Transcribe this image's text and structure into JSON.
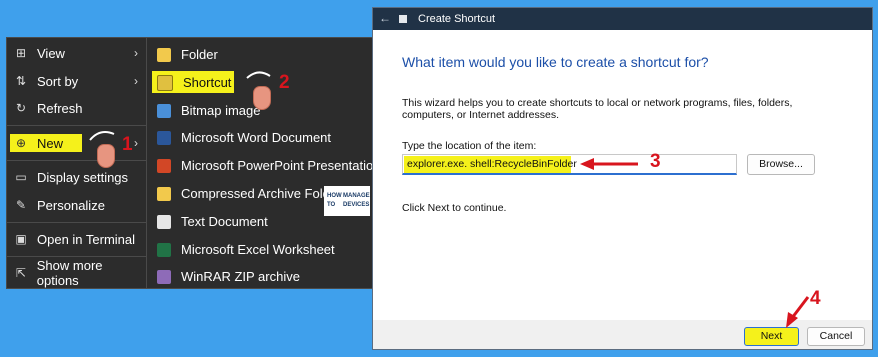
{
  "context_menu": {
    "items": [
      {
        "label": "View",
        "icon": "view-grid-icon",
        "glyph": "⊞",
        "arrow": "›"
      },
      {
        "label": "Sort by",
        "icon": "sort-icon",
        "glyph": "⇅",
        "arrow": "›"
      },
      {
        "label": "Refresh",
        "icon": "refresh-icon",
        "glyph": "↻"
      },
      {
        "label": "New",
        "icon": "new-plus-icon",
        "glyph": "⊕",
        "arrow": "›"
      },
      {
        "label": "Display settings",
        "icon": "display-icon",
        "glyph": "▭"
      },
      {
        "label": "Personalize",
        "icon": "brush-icon",
        "glyph": "✎"
      },
      {
        "label": "Open in Terminal",
        "icon": "terminal-icon",
        "glyph": "▣"
      },
      {
        "label": "Show more options",
        "icon": "share-more-icon",
        "glyph": "⇱"
      }
    ]
  },
  "new_submenu": {
    "items": [
      {
        "label": "Folder",
        "icon": "folder-icon",
        "color": "#f2c94c"
      },
      {
        "label": "Shortcut",
        "icon": "shortcut-icon",
        "color": "#e0c040"
      },
      {
        "label": "Bitmap image",
        "icon": "bitmap-icon",
        "color": "#4a90d9"
      },
      {
        "label": "Microsoft Word Document",
        "icon": "word-icon",
        "color": "#2b579a"
      },
      {
        "label": "Microsoft PowerPoint Presentation",
        "icon": "powerpoint-icon",
        "color": "#d24726"
      },
      {
        "label": "Compressed Archive Folder",
        "icon": "zip-folder-icon",
        "color": "#f2c94c"
      },
      {
        "label": "Text Document",
        "icon": "text-document-icon",
        "color": "#e6e6e6"
      },
      {
        "label": "Microsoft Excel Worksheet",
        "icon": "excel-icon",
        "color": "#217346"
      },
      {
        "label": "WinRAR ZIP archive",
        "icon": "winrar-icon",
        "color": "#8e6bb8"
      }
    ]
  },
  "dialog": {
    "title": "Create Shortcut",
    "back": "←",
    "question": "What item would you like to create a shortcut for?",
    "description": "This wizard helps you to create shortcuts to local or network programs, files, folders, computers, or Internet addresses.",
    "location_label": "Type the location of the item:",
    "location_value": "explorer.exe. shell:RecycleBinFolder",
    "browse_label": "Browse...",
    "continue_text": "Click Next to continue.",
    "next_label": "Next",
    "cancel_label": "Cancel"
  },
  "annotations": {
    "step1": "1",
    "step2": "2",
    "step3": "3",
    "step4": "4"
  },
  "logo": {
    "how": "HOW",
    "to": "TO",
    "manage": "MANAGE",
    "devices": "DEVICES"
  },
  "colors": {
    "highlight": "#f5f11b",
    "arrow": "#d8151e",
    "accent": "#1c4fa8"
  }
}
